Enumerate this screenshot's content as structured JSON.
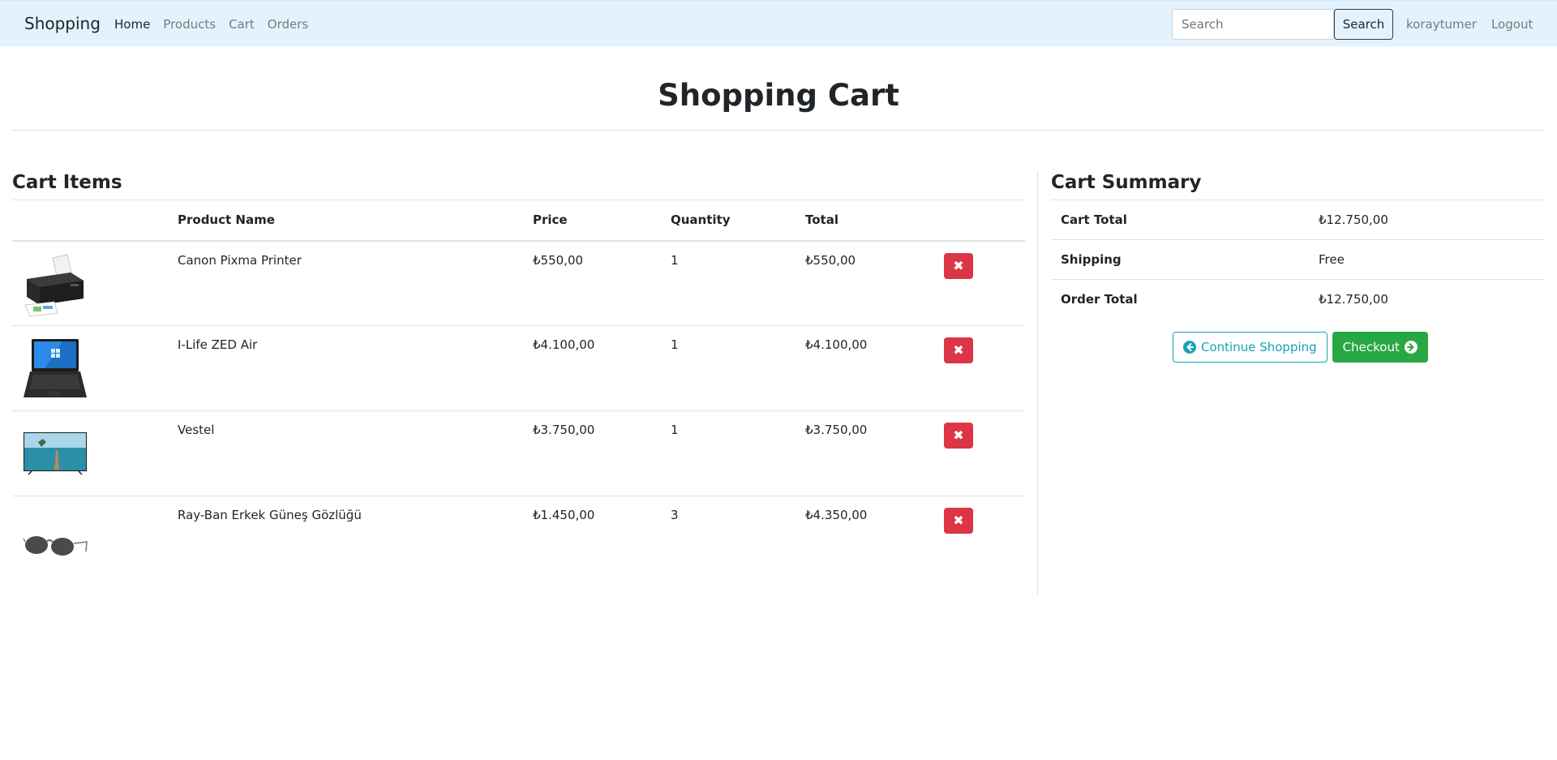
{
  "navbar": {
    "brand": "Shopping",
    "links": [
      "Home",
      "Products",
      "Cart",
      "Orders"
    ],
    "search_placeholder": "Search",
    "search_button": "Search",
    "username": "koraytumer",
    "logout": "Logout"
  },
  "page_title": "Shopping Cart",
  "cart_items": {
    "heading": "Cart Items",
    "columns": [
      "",
      "Product Name",
      "Price",
      "Quantity",
      "Total",
      ""
    ],
    "rows": [
      {
        "image": "printer-image",
        "name": "Canon Pixma Printer",
        "price": "₺550,00",
        "quantity": "1",
        "total": "₺550,00"
      },
      {
        "image": "laptop-image",
        "name": "I-Life ZED Air",
        "price": "₺4.100,00",
        "quantity": "1",
        "total": "₺4.100,00"
      },
      {
        "image": "tv-image",
        "name": "Vestel",
        "price": "₺3.750,00",
        "quantity": "1",
        "total": "₺3.750,00"
      },
      {
        "image": "sunglasses-image",
        "name": "Ray-Ban Erkek Güneş Gözlüğü",
        "price": "₺1.450,00",
        "quantity": "3",
        "total": "₺4.350,00"
      }
    ],
    "delete_icon": "times-icon"
  },
  "summary": {
    "heading": "Cart Summary",
    "rows": [
      {
        "label": "Cart Total",
        "value": "₺12.750,00"
      },
      {
        "label": "Shipping",
        "value": "Free"
      },
      {
        "label": "Order Total",
        "value": "₺12.750,00"
      }
    ],
    "continue_label": "Continue Shopping",
    "checkout_label": "Checkout"
  },
  "colors": {
    "navbar_bg": "#e3f2fd",
    "danger": "#dc3545",
    "success": "#28a745",
    "info": "#17a2b8"
  }
}
